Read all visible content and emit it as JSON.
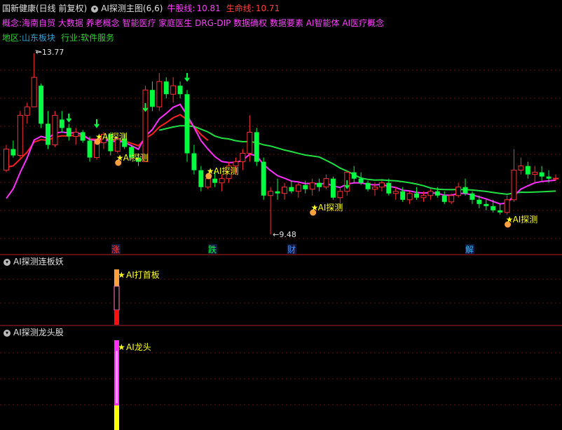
{
  "header": {
    "stock_title": "国新健康(日线 前复权)",
    "indicator_name": "AI探测主图(6,6)",
    "bull_label": "牛股线:",
    "bull_value": "10.81",
    "life_label": "生命线:",
    "life_value": "10.71",
    "concepts_label": "概念:",
    "concepts": "海南自贸 大数据 养老概念 智能医疗 家庭医生 DRG-DIP 数据确权 数据要素 AI智能体 AI医疗概念",
    "region_label": "地区:",
    "region": "山东板块",
    "industry_label": "行业:",
    "industry": "软件服务"
  },
  "annotations": {
    "high_label": "13.77",
    "low_label": "9.48",
    "probe_label": "AI探测",
    "markers": [
      "涨",
      "跌",
      "财",
      "解"
    ],
    "board_label": "AI打首板",
    "dragon_label": "AI龙头"
  },
  "panels": {
    "sub1_title": "AI探测连板妖",
    "sub2_title": "AI探测龙头股"
  },
  "colors": {
    "up": "#ff3030",
    "down": "#00ff40",
    "bull_line": "#ff30ff",
    "life_line": "#20e040",
    "red_ma": "#ff2020",
    "yellow": "#ffff20",
    "orange": "#ffa040"
  },
  "chart_data": [
    {
      "type": "candlestick",
      "title": "国新健康(日线 前复权)",
      "ylim": [
        9.3,
        14.0
      ],
      "series_lines": [
        {
          "name": "牛股线",
          "last": 10.81
        },
        {
          "name": "生命线",
          "last": 10.71
        }
      ],
      "ohlc": [
        [
          11.0,
          11.6,
          10.95,
          11.5
        ],
        [
          11.5,
          11.7,
          11.3,
          11.35
        ],
        [
          11.35,
          12.4,
          11.3,
          12.3
        ],
        [
          12.3,
          12.6,
          12.1,
          12.5
        ],
        [
          12.5,
          13.77,
          12.7,
          13.2
        ],
        [
          13.0,
          13.05,
          12.0,
          12.1
        ],
        [
          12.1,
          12.4,
          11.5,
          11.6
        ],
        [
          11.6,
          12.4,
          11.55,
          12.3
        ],
        [
          12.2,
          12.4,
          11.9,
          12.0
        ],
        [
          12.0,
          12.1,
          11.7,
          11.8
        ],
        [
          11.8,
          12.0,
          11.6,
          11.9
        ],
        [
          11.9,
          11.95,
          11.65,
          11.7
        ],
        [
          11.7,
          11.8,
          11.2,
          11.3
        ],
        [
          11.3,
          11.7,
          11.25,
          11.65
        ],
        [
          11.65,
          11.9,
          11.5,
          11.85
        ],
        [
          11.85,
          11.9,
          11.35,
          11.45
        ],
        [
          11.45,
          11.8,
          11.4,
          11.75
        ],
        [
          11.75,
          11.85,
          11.5,
          11.55
        ],
        [
          11.55,
          11.6,
          11.25,
          11.3
        ],
        [
          11.3,
          11.4,
          11.1,
          11.2
        ],
        [
          11.2,
          13.0,
          11.2,
          12.9
        ],
        [
          12.9,
          13.1,
          12.4,
          12.5
        ],
        [
          12.5,
          13.3,
          12.4,
          13.1
        ],
        [
          13.1,
          13.2,
          12.7,
          12.8
        ],
        [
          12.8,
          13.2,
          12.6,
          13.0
        ],
        [
          13.0,
          13.1,
          12.7,
          12.8
        ],
        [
          12.8,
          12.9,
          11.2,
          11.4
        ],
        [
          11.4,
          11.6,
          10.9,
          11.0
        ],
        [
          11.0,
          11.1,
          10.5,
          10.6
        ],
        [
          10.6,
          10.9,
          10.55,
          10.8
        ],
        [
          10.8,
          11.0,
          10.6,
          10.7
        ],
        [
          10.7,
          10.9,
          10.5,
          10.8
        ],
        [
          10.8,
          11.2,
          10.7,
          11.1
        ],
        [
          11.1,
          11.3,
          10.9,
          11.2
        ],
        [
          11.2,
          11.5,
          11.0,
          11.4
        ],
        [
          11.4,
          12.3,
          11.2,
          11.9
        ],
        [
          11.9,
          12.0,
          11.1,
          11.2
        ],
        [
          11.2,
          11.3,
          10.3,
          10.4
        ],
        [
          10.4,
          10.6,
          9.48,
          10.5
        ],
        [
          10.5,
          10.8,
          10.3,
          10.45
        ],
        [
          10.45,
          10.7,
          10.3,
          10.6
        ],
        [
          10.6,
          10.75,
          10.45,
          10.5
        ],
        [
          10.5,
          10.7,
          10.35,
          10.65
        ],
        [
          10.65,
          10.75,
          10.45,
          10.55
        ],
        [
          10.55,
          10.8,
          10.4,
          10.7
        ],
        [
          10.7,
          10.8,
          10.5,
          10.6
        ],
        [
          10.6,
          10.9,
          10.55,
          10.8
        ],
        [
          10.8,
          10.85,
          10.3,
          10.35
        ],
        [
          10.35,
          10.6,
          10.1,
          10.5
        ],
        [
          10.5,
          11.0,
          10.4,
          10.95
        ],
        [
          10.95,
          11.1,
          10.7,
          10.8
        ],
        [
          10.8,
          10.95,
          10.65,
          10.7
        ],
        [
          10.7,
          10.75,
          10.5,
          10.55
        ],
        [
          10.55,
          10.7,
          10.4,
          10.6
        ],
        [
          10.6,
          10.75,
          10.5,
          10.7
        ],
        [
          10.7,
          10.8,
          10.4,
          10.45
        ],
        [
          10.45,
          10.6,
          10.3,
          10.5
        ],
        [
          10.5,
          10.6,
          10.25,
          10.3
        ],
        [
          10.3,
          10.5,
          10.2,
          10.45
        ],
        [
          10.45,
          10.6,
          10.3,
          10.35
        ],
        [
          10.35,
          10.5,
          10.25,
          10.4
        ],
        [
          10.4,
          10.55,
          10.3,
          10.5
        ],
        [
          10.5,
          10.6,
          10.35,
          10.4
        ],
        [
          10.4,
          10.5,
          10.2,
          10.25
        ],
        [
          10.25,
          10.45,
          10.2,
          10.4
        ],
        [
          10.4,
          10.7,
          10.35,
          10.6
        ],
        [
          10.6,
          10.8,
          10.4,
          10.45
        ],
        [
          10.45,
          10.5,
          10.2,
          10.3
        ],
        [
          10.3,
          10.4,
          10.1,
          10.2
        ],
        [
          10.2,
          10.3,
          10.05,
          10.15
        ],
        [
          10.15,
          10.3,
          10.0,
          10.05
        ],
        [
          10.05,
          10.2,
          9.95,
          10.0
        ],
        [
          10.0,
          10.4,
          9.95,
          10.3
        ],
        [
          10.3,
          11.5,
          10.25,
          11.0
        ],
        [
          11.0,
          11.3,
          10.9,
          11.1
        ],
        [
          11.1,
          11.2,
          10.8,
          10.9
        ],
        [
          10.9,
          11.1,
          10.7,
          10.95
        ],
        [
          10.95,
          11.1,
          10.75,
          10.85
        ],
        [
          10.85,
          11.0,
          10.7,
          10.8
        ],
        [
          10.8,
          10.9,
          10.75,
          10.81
        ]
      ]
    },
    {
      "type": "bar",
      "title": "AI探测连板妖",
      "categories": [
        "signal"
      ],
      "annotation": "AI打首板"
    },
    {
      "type": "bar",
      "title": "AI探测龙头股",
      "categories": [
        "signal"
      ],
      "annotation": "AI龙头"
    }
  ]
}
